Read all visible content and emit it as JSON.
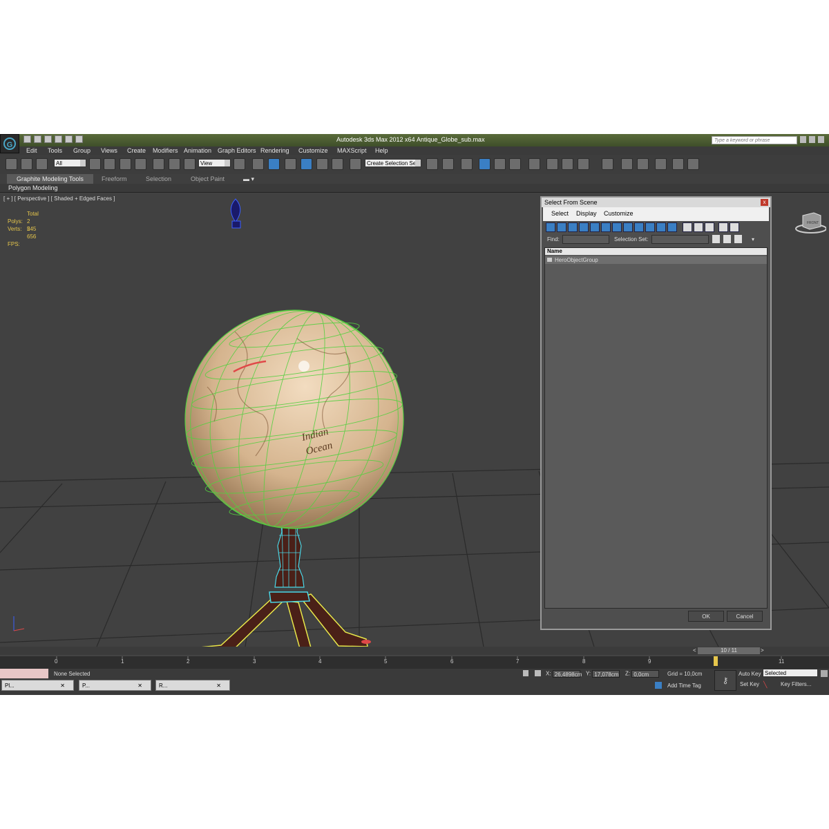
{
  "app": {
    "title": "Autodesk 3ds Max  2012 x64",
    "file": "Antique_Globe_sub.max",
    "search_placeholder": "Type a keyword or phrase"
  },
  "menu": [
    "Edit",
    "Tools",
    "Group",
    "Views",
    "Create",
    "Modifiers",
    "Animation",
    "Graph Editors",
    "Rendering",
    "Customize",
    "MAXScript",
    "Help"
  ],
  "toolbar": {
    "filter_value": "All",
    "coord_value": "View",
    "selection_set_placeholder": "Create Selection Se"
  },
  "ribbon": {
    "tabs": [
      "Graphite Modeling Tools",
      "Freeform",
      "Selection",
      "Object Paint"
    ],
    "panel": "Polygon Modeling"
  },
  "viewport": {
    "label": "[ + ] [ Perspective ] [ Shaded + Edged Faces ]",
    "stats": {
      "total": "Total",
      "polys_label": "Polys:",
      "polys": "2 545",
      "verts_label": "Verts:",
      "verts": "2 656",
      "fps_label": "FPS:"
    },
    "viewcube_label": "FRONT",
    "globe_text": [
      "Indian",
      "Ocean"
    ]
  },
  "dialog": {
    "title": "Select From Scene",
    "close": "x",
    "menu": [
      "Select",
      "Display",
      "Customize"
    ],
    "find_label": "Find:",
    "selection_set_label": "Selection Set:",
    "column": "Name",
    "items": [
      "HeroObjectGroup"
    ],
    "ok": "OK",
    "cancel": "Cancel"
  },
  "timeline": {
    "frame": "10 / 11",
    "ticks": [
      "0",
      "1",
      "2",
      "3",
      "4",
      "5",
      "6",
      "7",
      "8",
      "9",
      "11"
    ],
    "prev": "<",
    "next": ">"
  },
  "status": {
    "selection": "None Selected",
    "x_label": "X:",
    "x": "26,4898cm",
    "y_label": "Y:",
    "y": "17,078cm",
    "z_label": "Z:",
    "z": "0,0cm",
    "grid": "Grid = 10,0cm",
    "add_time_tag": "Add Time Tag",
    "auto_key": "Auto Key",
    "auto_key_value": "Selected",
    "set_key": "Set Key",
    "key_filters": "Key Filters..."
  },
  "taskbar": [
    {
      "label": "Pl..."
    },
    {
      "label": "P..."
    },
    {
      "label": "R..."
    }
  ],
  "colors": {
    "wire_green": "#55d040",
    "wire_cyan": "#49d8e8",
    "wire_yellow": "#e8e84a",
    "wire_blue": "#3b5fff",
    "wood": "#4a2018",
    "globe": "#d8b890"
  }
}
